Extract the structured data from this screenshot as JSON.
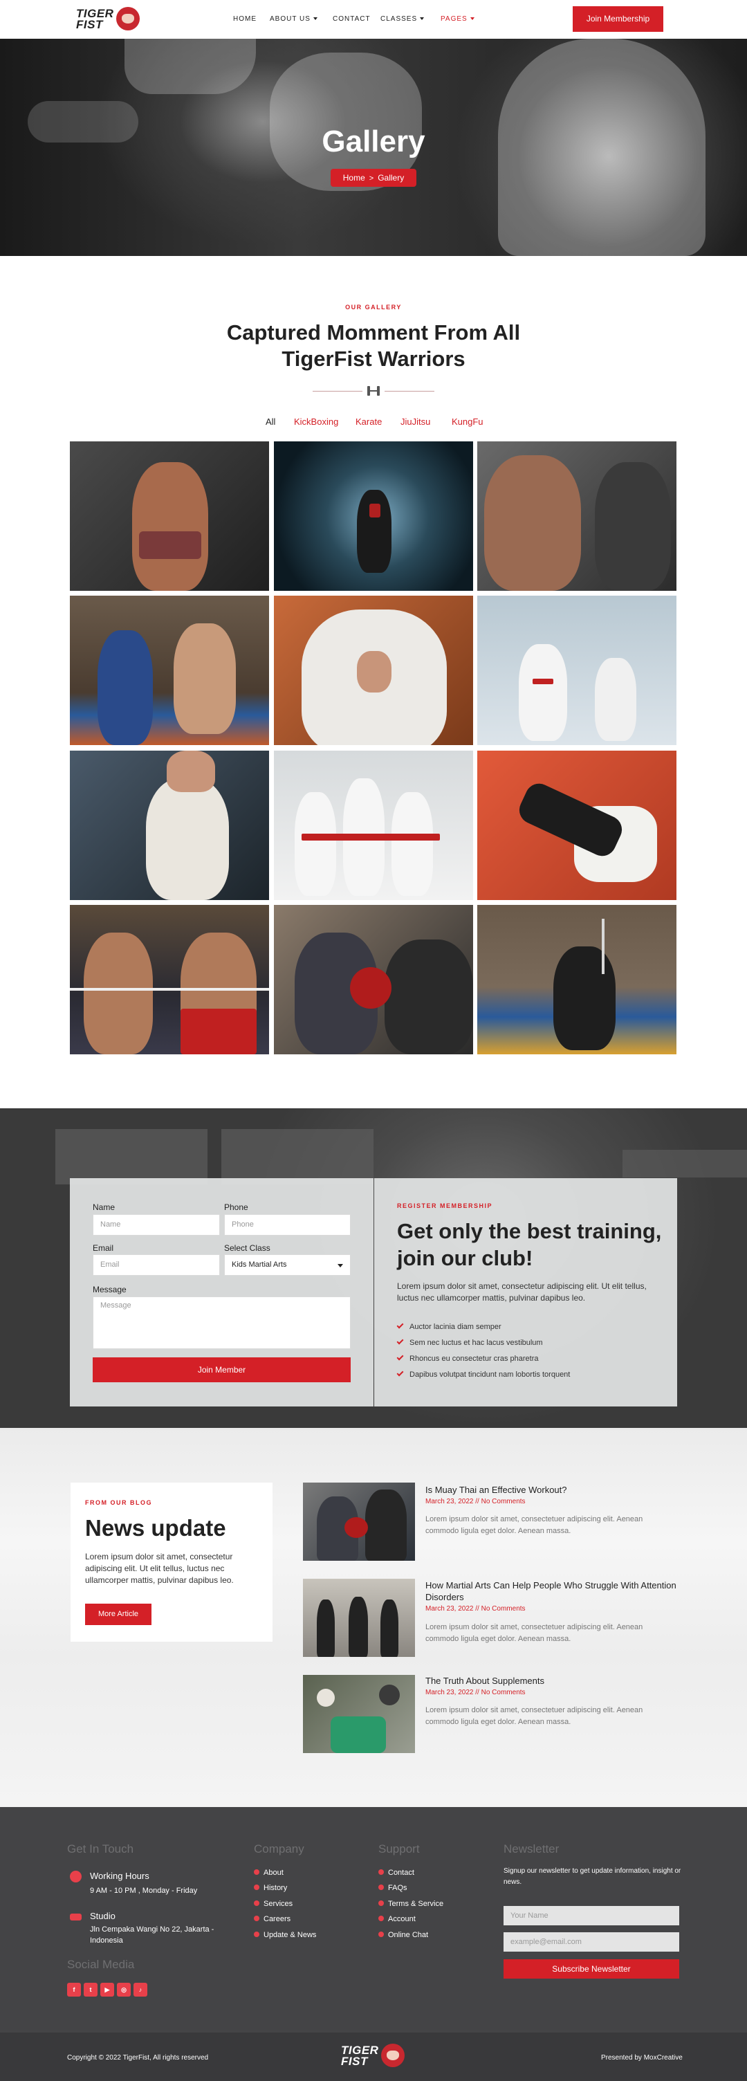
{
  "header": {
    "logo": {
      "line1": "TIGER",
      "line2": "FIST"
    },
    "nav": [
      {
        "label": "HOME",
        "dropdown": false,
        "active": false
      },
      {
        "label": "ABOUT US",
        "dropdown": true,
        "active": false
      },
      {
        "label": "CONTACT",
        "dropdown": false,
        "active": false
      },
      {
        "label": "CLASSES",
        "dropdown": true,
        "active": false
      },
      {
        "label": "PAGES",
        "dropdown": true,
        "active": true
      }
    ],
    "cta_label": "Join Membership"
  },
  "hero": {
    "title": "Gallery",
    "breadcrumb": {
      "home": "Home",
      "separator": ">",
      "current": "Gallery"
    }
  },
  "gallery": {
    "eyebrow": "OUR GALLERY",
    "title_line1": "Captured Momment From All",
    "title_line2": "TigerFist Warriors",
    "filters": [
      "All",
      "KickBoxing",
      "Karate",
      "JiuJitsu",
      "KungFu"
    ],
    "active_filter": "All"
  },
  "membership": {
    "form": {
      "name_label": "Name",
      "name_placeholder": "Name",
      "phone_label": "Phone",
      "phone_placeholder": "Phone",
      "email_label": "Email",
      "email_placeholder": "Email",
      "class_label": "Select Class",
      "class_value": "Kids Martial Arts",
      "message_label": "Message",
      "message_placeholder": "Message",
      "submit_label": "Join Member"
    },
    "eyebrow": "REGISTER MEMBERSHIP",
    "title_line1": "Get only the best training,",
    "title_line2": "join our club!",
    "description_line1": "Lorem ipsum dolor sit amet, consectetur adipiscing elit. Ut elit tellus,",
    "description_line2": "luctus nec ullamcorper mattis, pulvinar dapibus leo.",
    "benefits": [
      "Auctor lacinia diam semper",
      "Sem nec luctus et hac lacus vestibulum",
      "Rhoncus eu consectetur cras pharetra",
      "Dapibus volutpat tincidunt nam lobortis torquent"
    ]
  },
  "blog": {
    "eyebrow": "FROM OUR BLOG",
    "title": "News update",
    "description_line1": "Lorem ipsum dolor sit amet, consectetur",
    "description_line2": "adipiscing elit. Ut elit tellus, luctus nec",
    "description_line3": "ullamcorper mattis, pulvinar dapibus leo.",
    "button_label": "More Article",
    "posts": [
      {
        "title_line1": "Is Muay Thai an Effective Workout?",
        "title_line2": "",
        "date": "March 23, 2022",
        "sep": "//",
        "comments": "No Comments",
        "excerpt_line1": "Lorem ipsum dolor sit amet, consectetuer adipiscing elit. Aenean",
        "excerpt_line2": "commodo ligula eget dolor. Aenean massa."
      },
      {
        "title_line1": "How Martial Arts Can Help People Who Struggle With Attention",
        "title_line2": "Disorders",
        "date": "March 23, 2022",
        "sep": "//",
        "comments": "No Comments",
        "excerpt_line1": "Lorem ipsum dolor sit amet, consectetuer adipiscing elit. Aenean",
        "excerpt_line2": "commodo ligula eget dolor. Aenean massa."
      },
      {
        "title_line1": "The Truth About Supplements",
        "title_line2": "",
        "date": "March 23, 2022",
        "sep": "//",
        "comments": "No Comments",
        "excerpt_line1": "Lorem ipsum dolor sit amet, consectetuer adipiscing elit. Aenean",
        "excerpt_line2": "commodo ligula eget dolor. Aenean massa."
      }
    ]
  },
  "footer": {
    "contact": {
      "heading": "Get In Touch",
      "hours_title": "Working Hours",
      "hours_value": "9 AM - 10 PM , Monday - Friday",
      "studio_title": "Studio",
      "studio_line1": "Jln Cempaka Wangi No 22, Jakarta -",
      "studio_line2": "Indonesia"
    },
    "social_heading": "Social Media",
    "social_icons": [
      "facebook-icon",
      "twitter-icon",
      "youtube-icon",
      "instagram-icon",
      "tiktok-icon"
    ],
    "social_glyphs": [
      "f",
      "t",
      "▶",
      "◎",
      "♪"
    ],
    "company": {
      "heading": "Company",
      "links": [
        "About",
        "History",
        "Services",
        "Careers",
        "Update & News"
      ]
    },
    "support": {
      "heading": "Support",
      "links": [
        "Contact",
        "FAQs",
        "Terms & Service",
        "Account",
        "Online Chat"
      ]
    },
    "newsletter": {
      "heading": "Newsletter",
      "text_line1": "Signup our newsletter to get update information, insight or",
      "text_line2": "news.",
      "name_placeholder": "Your Name",
      "email_placeholder": "example@email.com",
      "button_label": "Subscribe Newsletter"
    },
    "copyright": "Copyright © 2022 TigerFist, All rights reserved",
    "presented": "Presented by MoxCreative"
  },
  "colors": {
    "accent": "#d42027",
    "footer": "#444446",
    "footer_bottom": "#39393b"
  }
}
